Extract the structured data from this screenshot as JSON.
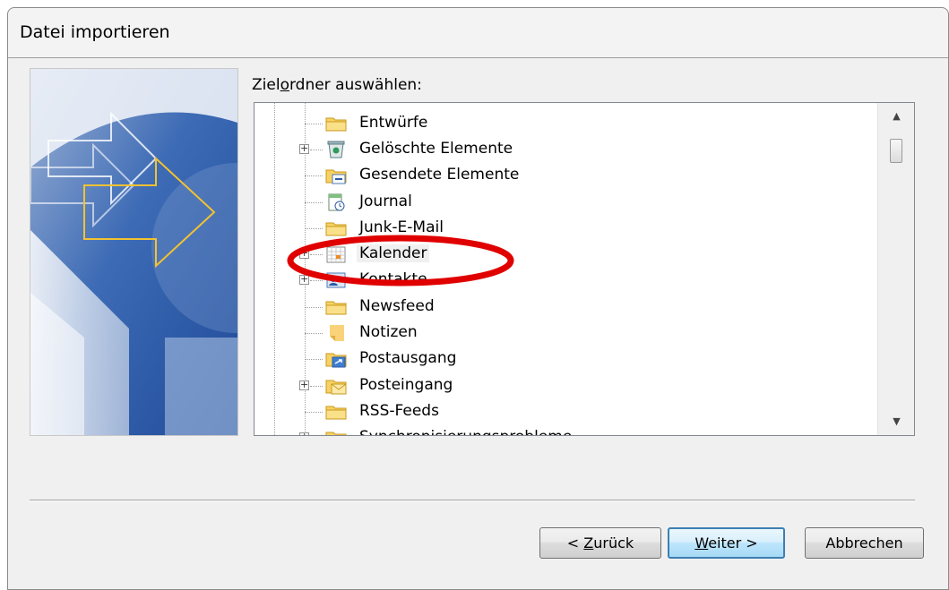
{
  "window": {
    "title": "Datei importieren"
  },
  "folder_picker": {
    "label_pre": "Ziel",
    "label_accel": "o",
    "label_post": "rdner auswählen:",
    "items": [
      {
        "label": "Entwürfe",
        "icon": "folder-icon",
        "expandable": false
      },
      {
        "label": "Gelöschte Elemente",
        "icon": "deleted-items-icon",
        "expandable": true
      },
      {
        "label": "Gesendete Elemente",
        "icon": "sent-items-icon",
        "expandable": false
      },
      {
        "label": "Journal",
        "icon": "journal-icon",
        "expandable": false
      },
      {
        "label": "Junk-E-Mail",
        "icon": "folder-icon",
        "expandable": false
      },
      {
        "label": "Kalender",
        "icon": "calendar-icon",
        "expandable": true,
        "selected": true
      },
      {
        "label": "Kontakte",
        "icon": "contacts-icon",
        "expandable": true
      },
      {
        "label": "Newsfeed",
        "icon": "folder-icon",
        "expandable": false
      },
      {
        "label": "Notizen",
        "icon": "notes-icon",
        "expandable": false
      },
      {
        "label": "Postausgang",
        "icon": "outbox-icon",
        "expandable": false
      },
      {
        "label": "Posteingang",
        "icon": "inbox-icon",
        "expandable": true
      },
      {
        "label": "RSS-Feeds",
        "icon": "folder-icon",
        "expandable": false
      },
      {
        "label": "Synchronisierungsprobleme",
        "icon": "folder-icon",
        "expandable": true
      }
    ]
  },
  "buttons": {
    "back_accel": "Z",
    "back_pre": "< ",
    "back_post": "urück",
    "next_accel": "W",
    "next_post": "eiter >",
    "cancel": "Abbrechen"
  },
  "colors": {
    "highlight_ring": "#e00000",
    "wizard_blue": "#2a5aa8",
    "arrow_yellow": "#f2c230"
  }
}
